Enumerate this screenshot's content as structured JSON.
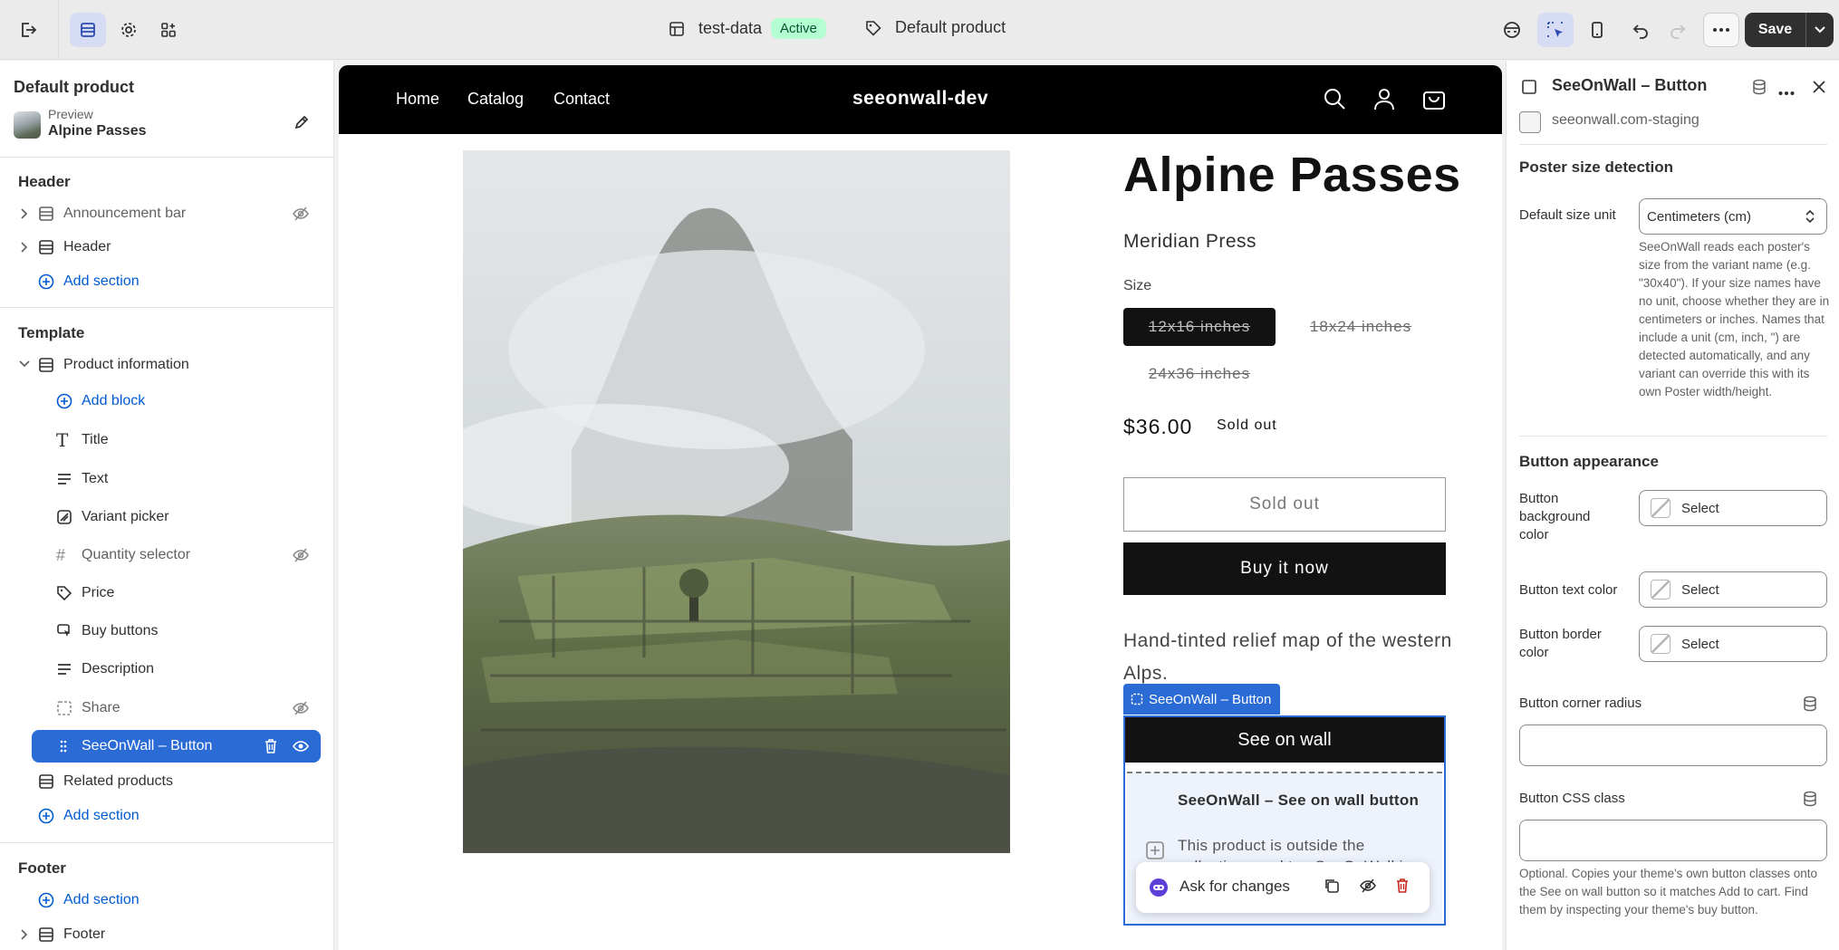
{
  "topbar": {
    "theme_name": "test-data",
    "theme_status": "Active",
    "template_name": "Default product",
    "save_label": "Save"
  },
  "left_panel": {
    "title": "Default product",
    "preview_label": "Preview",
    "preview_product": "Alpine Passes",
    "header_group": {
      "title": "Header",
      "items": [
        "Announcement bar",
        "Header"
      ],
      "add_section": "Add section"
    },
    "template_group": {
      "title": "Template",
      "section": "Product information",
      "add_block": "Add block",
      "blocks": [
        "Title",
        "Text",
        "Variant picker",
        "Quantity selector",
        "Price",
        "Buy buttons",
        "Description",
        "Share",
        "SeeOnWall – Button"
      ],
      "related": "Related products",
      "add_section": "Add section"
    },
    "footer_group": {
      "title": "Footer",
      "add_section": "Add section",
      "items": [
        "Footer"
      ]
    }
  },
  "store": {
    "nav": [
      "Home",
      "Catalog",
      "Contact"
    ],
    "brand": "seeonwall-dev",
    "product": {
      "title": "Alpine Passes",
      "vendor": "Meridian Press",
      "size_label": "Size",
      "sizes": [
        "12x16 inches",
        "18x24 inches",
        "24x36 inches"
      ],
      "price": "$36.00",
      "price_badge": "Sold out",
      "sold_out_button": "Sold out",
      "buy_now_button": "Buy it now",
      "description": "Hand-tinted relief map of the western Alps."
    },
    "seeonwall": {
      "tag": "SeeOnWall – Button",
      "button": "See on wall",
      "placeholder_title": "SeeOnWall – See on wall button",
      "placeholder_body": "This product is outside the collections and tag SeeOnWall is"
    },
    "ask_bar": {
      "label": "Ask for changes"
    }
  },
  "right_panel": {
    "title": "SeeOnWall – Button",
    "app_source": "seeonwall.com-staging",
    "poster_section": "Poster size detection",
    "default_unit_label": "Default size unit",
    "default_unit_value": "Centimeters (cm)",
    "default_unit_help": "SeeOnWall reads each poster's size from the variant name (e.g. \"30x40\"). If your size names have no unit, choose whether they are in centimeters or inches. Names that include a unit (cm, inch, \") are detected automatically, and any variant can override this with its own Poster width/height.",
    "appearance_section": "Button appearance",
    "bg_color_label": "Button background color",
    "text_color_label": "Button text color",
    "border_color_label": "Button border color",
    "select_label": "Select",
    "corner_radius_label": "Button corner radius",
    "css_class_label": "Button CSS class",
    "css_class_help": "Optional. Copies your theme's own button classes onto the See on wall button so it matches Add to cart. Find them by inspecting your theme's buy button."
  }
}
